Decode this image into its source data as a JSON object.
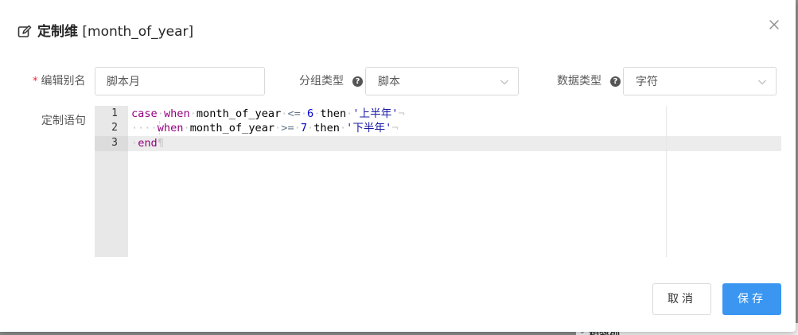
{
  "background": {
    "peek_label": "相邻列"
  },
  "dialog": {
    "title_bold": "定制维",
    "title_field": "[month_of_year]",
    "icons": {
      "title": "edit-icon",
      "close": "close-icon"
    }
  },
  "form": {
    "alias": {
      "required_mark": "*",
      "label": "编辑别名",
      "value": "脚本月"
    },
    "group_type": {
      "label": "分组类型",
      "help": "?",
      "selected": "脚本"
    },
    "data_type": {
      "label": "数据类型",
      "help": "?",
      "selected": "字符"
    },
    "statement": {
      "label": "定制语句",
      "line_numbers": [
        "1",
        "2",
        "3"
      ],
      "lines": [
        {
          "tokens": [
            {
              "t": "case",
              "c": "kw"
            },
            {
              "t": "·",
              "c": "ws"
            },
            {
              "t": "when",
              "c": "kw"
            },
            {
              "t": "·",
              "c": "ws"
            },
            {
              "t": "month_of_year",
              "c": ""
            },
            {
              "t": "·",
              "c": "ws"
            },
            {
              "t": "<=",
              "c": "op"
            },
            {
              "t": "·",
              "c": "ws"
            },
            {
              "t": "6",
              "c": "num"
            },
            {
              "t": "·",
              "c": "ws"
            },
            {
              "t": "then",
              "c": ""
            },
            {
              "t": "·",
              "c": "ws"
            },
            {
              "t": "'上半年'",
              "c": "str"
            },
            {
              "t": "¬",
              "c": "ws"
            }
          ]
        },
        {
          "tokens": [
            {
              "t": "····",
              "c": "ws"
            },
            {
              "t": "when",
              "c": "kw"
            },
            {
              "t": "·",
              "c": "ws"
            },
            {
              "t": "month_of_year",
              "c": ""
            },
            {
              "t": "·",
              "c": "ws"
            },
            {
              "t": ">=",
              "c": "op"
            },
            {
              "t": "·",
              "c": "ws"
            },
            {
              "t": "7",
              "c": "num"
            },
            {
              "t": "·",
              "c": "ws"
            },
            {
              "t": "then",
              "c": ""
            },
            {
              "t": "·",
              "c": "ws"
            },
            {
              "t": "'下半年'",
              "c": "str"
            },
            {
              "t": "¬",
              "c": "ws"
            }
          ]
        },
        {
          "tokens": [
            {
              "t": "·",
              "c": "ws"
            },
            {
              "t": "end",
              "c": "kw"
            },
            {
              "t": "¶",
              "c": "ws"
            }
          ]
        }
      ]
    }
  },
  "footer": {
    "cancel_label": "取消",
    "save_label": "保存"
  },
  "colors": {
    "primary": "#3a96f0",
    "required": "#f5222d",
    "keyword": "#93007f",
    "number": "#0000cd",
    "string": "#1a1aa6"
  }
}
